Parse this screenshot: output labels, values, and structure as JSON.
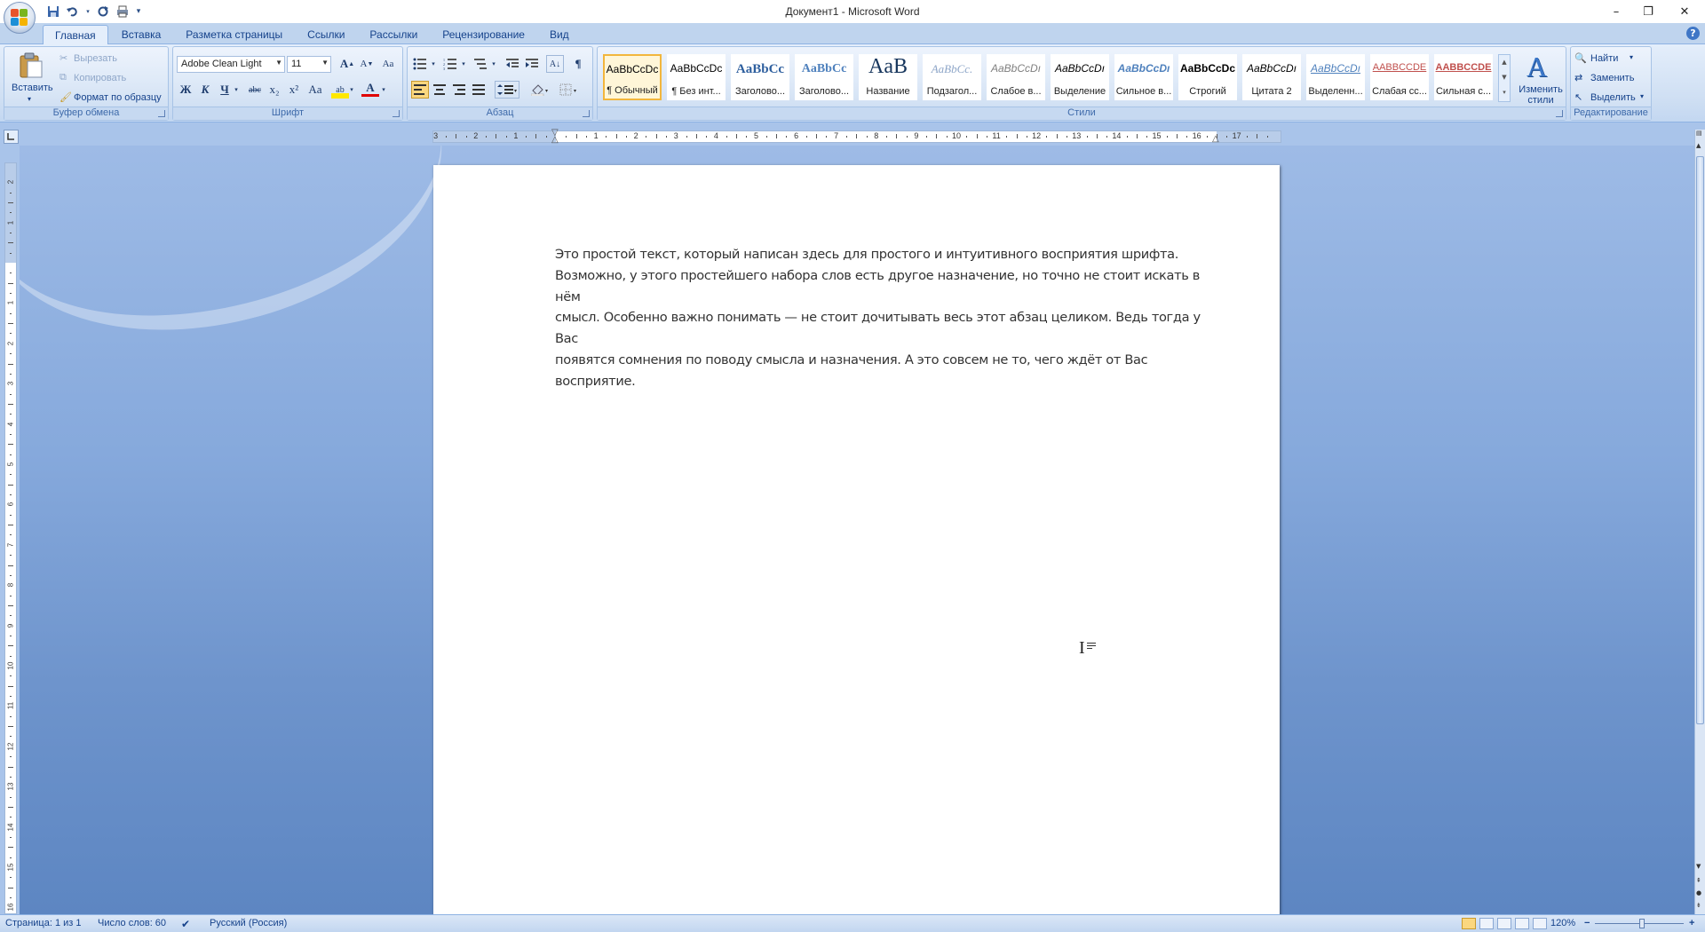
{
  "window": {
    "title": "Документ1 - Microsoft Word",
    "minimize": "–",
    "restore": "❐",
    "close": "✕"
  },
  "qat": {
    "save_icon": "save-icon",
    "undo_icon": "undo-icon",
    "redo_icon": "redo-icon",
    "print_icon": "print-icon",
    "customize_icon": "customize-icon"
  },
  "tabs": [
    {
      "label": "Главная",
      "active": true
    },
    {
      "label": "Вставка"
    },
    {
      "label": "Разметка страницы"
    },
    {
      "label": "Ссылки"
    },
    {
      "label": "Рассылки"
    },
    {
      "label": "Рецензирование"
    },
    {
      "label": "Вид"
    }
  ],
  "help": "?",
  "clipboard": {
    "group": "Буфер обмена",
    "paste": "Вставить",
    "cut": "Вырезать",
    "copy": "Копировать",
    "format_painter": "Формат по образцу"
  },
  "font": {
    "group": "Шрифт",
    "font_name": "Adobe Clean Light",
    "font_size": "11",
    "grow": "A",
    "shrink": "A",
    "clear": "Aa",
    "bold": "Ж",
    "italic": "К",
    "underline": "Ч",
    "strike": "abc",
    "subscript": "x₂",
    "superscript": "x²",
    "case": "Aa",
    "highlight": "ab",
    "color": "A"
  },
  "paragraph": {
    "group": "Абзац",
    "pilcrow": "¶"
  },
  "styles": {
    "group": "Стили",
    "items": [
      {
        "sample": "AaBbCcDc",
        "name": "¶ Обычный",
        "active": true
      },
      {
        "sample": "AaBbCcDc",
        "name": "¶ Без инт..."
      },
      {
        "sample": "AaBbCc",
        "name": "Заголово..."
      },
      {
        "sample": "AaBbCc",
        "name": "Заголово..."
      },
      {
        "sample": "AaB",
        "name": "Название"
      },
      {
        "sample": "AaBbCc.",
        "name": "Подзагол..."
      },
      {
        "sample": "AaBbCcDı",
        "name": "Слабое в..."
      },
      {
        "sample": "AaBbCcDı",
        "name": "Выделение"
      },
      {
        "sample": "AaBbCcDı",
        "name": "Сильное в..."
      },
      {
        "sample": "AaBbCcDc",
        "name": "Строгий"
      },
      {
        "sample": "AaBbCcDı",
        "name": "Цитата 2"
      },
      {
        "sample": "AaBbCcDı",
        "name": "Выделенн..."
      },
      {
        "sample": "AABBCCDE",
        "name": "Слабая сс..."
      },
      {
        "sample": "AABBCCDE",
        "name": "Сильная с..."
      }
    ],
    "change_styles": "Изменить стили"
  },
  "editing": {
    "group": "Редактирование",
    "find": "Найти",
    "replace": "Заменить",
    "select": "Выделить"
  },
  "ruler": {
    "h_ticks": [
      "3",
      "2",
      "1",
      "1",
      "2",
      "3",
      "4",
      "5",
      "6",
      "7",
      "8",
      "9",
      "10",
      "11",
      "12",
      "13",
      "14",
      "15",
      "16",
      "17"
    ],
    "v_ticks": [
      "2",
      "1",
      "1",
      "2",
      "3",
      "4",
      "5",
      "6",
      "7",
      "8",
      "9",
      "10",
      "11",
      "12",
      "13",
      "14",
      "15",
      "16"
    ]
  },
  "document": {
    "paragraphs": [
      "Это простой текст, который написан здесь для простого и интуитивного восприятия шрифта.",
      "Возможно, у этого простейшего набора слов есть другое назначение, но точно не стоит искать в нём",
      "смысл. Особенно важно понимать — не стоит дочитывать весь этот абзац целиком. Ведь тогда у Вас",
      "появятся сомнения по поводу смысла и назначения. А это совсем не то, чего ждёт от Вас",
      "восприятие."
    ],
    "cursor": "I"
  },
  "status": {
    "page": "Страница: 1 из 1",
    "words": "Число слов: 60",
    "language": "Русский (Россия)",
    "zoom": "120%",
    "zoom_out": "−",
    "zoom_in": "+"
  },
  "colors": {
    "accent": "#15428b",
    "ribbon": "#dbe7f7",
    "active_style": "#f2b63d"
  }
}
